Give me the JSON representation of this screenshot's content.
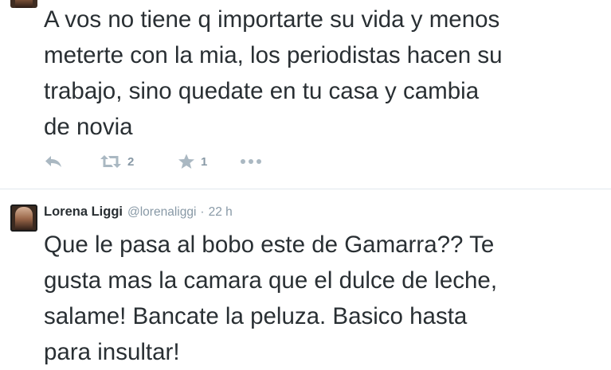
{
  "tweet1": {
    "text": "A vos no tiene q importarte su vida y menos\nmeterte con la mia, los periodistas hacen su\ntrabajo, sino quedate en tu casa y cambia\nde novia",
    "retweet_count": "2",
    "favorite_count": "1",
    "icons": {
      "reply": "reply-icon",
      "retweet": "retweet-icon",
      "favorite": "star-icon",
      "more": "more-icon"
    }
  },
  "tweet2": {
    "display_name": "Lorena Liggi",
    "screen_name": "@lorenaliggi",
    "separator": "·",
    "timestamp": "22 h",
    "text": "Que le pasa al bobo este de Gamarra?? Te\ngusta mas la camara que el dulce de leche,\nsalame! Bancate la peluza. Basico hasta\npara insultar!"
  },
  "colors": {
    "text": "#292f33",
    "muted": "#8899a6",
    "icon": "#aab8c2",
    "divider": "#e1e8ed"
  }
}
